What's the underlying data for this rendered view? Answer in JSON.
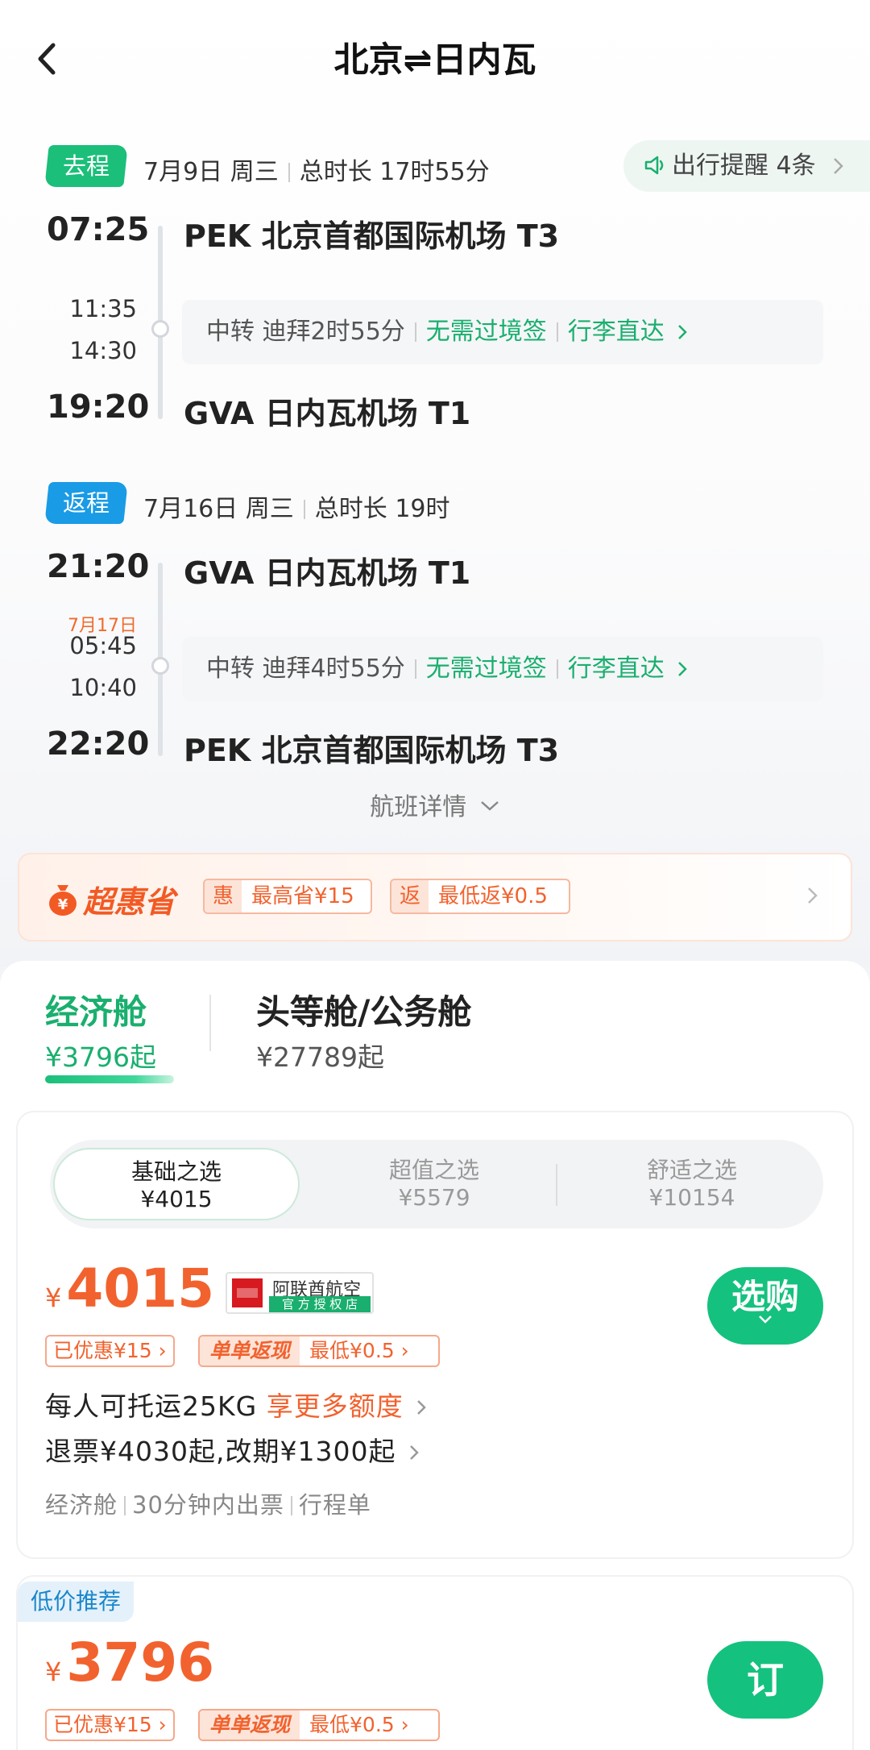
{
  "header": {
    "title": "北京⇌日内瓦"
  },
  "reminder": {
    "label": "出行提醒 4条"
  },
  "outbound": {
    "tag": "去程",
    "date": "7月9日 周三",
    "duration": "总时长 17时55分",
    "dep_time": "07:25",
    "dep_airport": "PEK 北京首都国际机场 T3",
    "arr_stop": "11:35",
    "dep_stop": "14:30",
    "transfer": "中转 迪拜2时55分",
    "visa": "无需过境签",
    "baggage": "行李直达",
    "arr_time": "19:20",
    "arr_airport": "GVA 日内瓦机场 T1"
  },
  "inbound": {
    "tag": "返程",
    "date": "7月16日 周三",
    "duration": "总时长 19时",
    "dep_time": "21:20",
    "dep_airport": "GVA 日内瓦机场 T1",
    "stop_date": "7月17日",
    "arr_stop": "05:45",
    "dep_stop": "10:40",
    "transfer": "中转 迪拜4时55分",
    "visa": "无需过境签",
    "baggage": "行李直达",
    "arr_time": "22:20",
    "arr_airport": "PEK 北京首都国际机场 T3"
  },
  "flight_details": "航班详情",
  "promo": {
    "title": "超惠省",
    "chip1_key": "惠",
    "chip1_text": "最高省¥15",
    "chip2_key": "返",
    "chip2_text": "最低返¥0.5"
  },
  "cabins": [
    {
      "label": "经济舱",
      "price": "¥3796起"
    },
    {
      "label": "头等舱/公务舱",
      "price": "¥27789起"
    }
  ],
  "options": [
    {
      "label": "基础之选",
      "price": "¥4015"
    },
    {
      "label": "超值之选",
      "price": "¥5579"
    },
    {
      "label": "舒适之选",
      "price": "¥10154"
    }
  ],
  "fare1": {
    "currency": "¥",
    "price": "4015",
    "airline": "阿联酋航空",
    "airline_sub": "官 方 授 权 店",
    "discount": "已优惠¥15",
    "cash_key": "单单返现",
    "cash_text": "最低¥0.5",
    "baggage": "每人可托运25KG",
    "baggage_more": "享更多额度",
    "refund": "退票¥4030起,改期¥1300起",
    "meta1": "经济舱",
    "meta2": "30分钟内出票",
    "meta3": "行程单",
    "button": "选购"
  },
  "fare2": {
    "tag": "低价推荐",
    "currency": "¥",
    "price": "3796",
    "discount": "已优惠¥15",
    "cash_key": "单单返现",
    "cash_text": "最低¥0.5",
    "button": "订"
  },
  "colors": {
    "accent": "#1bbf7a",
    "orange": "#f2622e",
    "blue": "#1a9be6"
  }
}
